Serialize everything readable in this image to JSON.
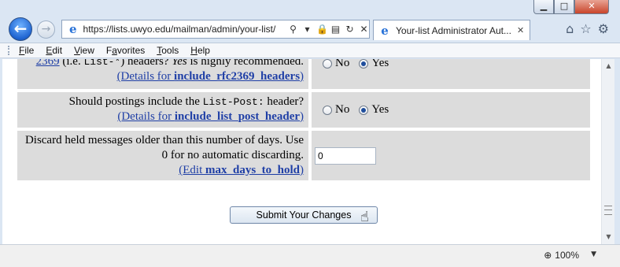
{
  "window": {
    "minimize_icon": "minimize-icon",
    "maximize_icon": "maximize-icon",
    "close_icon": "close-icon"
  },
  "nav": {
    "url": "https://lists.uwyo.edu/mailman/admin/your-list/",
    "tab_title": "Your-list Administrator Aut...",
    "tab_close": "✕"
  },
  "menu": {
    "items": [
      {
        "label": "File",
        "accel": "F"
      },
      {
        "label": "Edit",
        "accel": "E"
      },
      {
        "label": "View",
        "accel": "V"
      },
      {
        "label": "Favorites",
        "accel": "a"
      },
      {
        "label": "Tools",
        "accel": "T"
      },
      {
        "label": "Help",
        "accel": "H"
      }
    ]
  },
  "settings": {
    "row1": {
      "link_prefix": "2369",
      "text_part": "(i.e. ",
      "mono": "List-*",
      "text_after": ") headers? ",
      "italic": "Yes",
      "text_end": " is highly recommended.",
      "details_prefix": "(Details for ",
      "details_name": "include_rfc2369_headers",
      "details_suffix": ")",
      "no_label": "No",
      "yes_label": "Yes"
    },
    "row2": {
      "question_prefix": "Should postings include the ",
      "mono": "List-Post:",
      "question_suffix": " header?",
      "details_prefix": "(Details for ",
      "details_name": "include_list_post_header",
      "details_suffix": ")",
      "no_label": "No",
      "yes_label": "Yes"
    },
    "row3": {
      "question_line1": "Discard held messages older than this number of days. Use",
      "question_line2": "0 for no automatic discarding.",
      "details_prefix": "(Edit ",
      "details_name": "max_days_to_hold",
      "details_suffix": ")",
      "value": "0"
    }
  },
  "submit_label": "Submit Your Changes",
  "status": {
    "zoom": "100%"
  }
}
